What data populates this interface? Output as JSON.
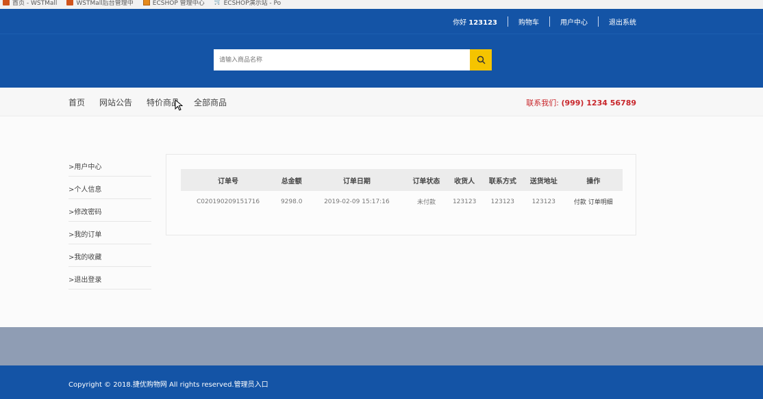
{
  "bookmarks": [
    {
      "icon": "wst-icon",
      "label": "首页 - WSTMall"
    },
    {
      "icon": "wst-icon",
      "label": "WSTMall后台管理中"
    },
    {
      "icon": "ecshop-icon",
      "label": "ECSHOP 管理中心"
    },
    {
      "icon": "cart-icon",
      "label": "ECSHOP演示站 - Po"
    }
  ],
  "header": {
    "greeting": "你好",
    "username": "123123",
    "links": [
      "购物车",
      "用户中心",
      "退出系统"
    ],
    "search_placeholder": "请输入商品名称",
    "colors": {
      "primary": "#1454a6",
      "search_button": "#f5c400"
    }
  },
  "nav": {
    "items": [
      "首页",
      "网站公告",
      "特价商品",
      "全部商品"
    ],
    "contact_label": "联系我们:",
    "contact_phone": "(999) 1234 56789",
    "contact_color": "#c8262b"
  },
  "sidebar": {
    "items": [
      ">用户中心",
      ">个人信息",
      ">修改密码",
      ">我的订单",
      ">我的收藏",
      ">退出登录"
    ]
  },
  "orders": {
    "columns": [
      "订单号",
      "总金额",
      "订单日期",
      "订单状态",
      "收货人",
      "联系方式",
      "送货地址",
      "操作"
    ],
    "rows": [
      {
        "order_no": "C020190209151716",
        "total": "9298.0",
        "date": "2019-02-09 15:17:16",
        "status": "未付款",
        "receiver": "123123",
        "contact": "123123",
        "address": "123123",
        "actions": [
          "付款",
          "订单明细"
        ]
      }
    ]
  },
  "footer": {
    "copyright": "Copyright © 2018.捷优购物网 All rights reserved.",
    "admin_link": "管理员入口"
  }
}
